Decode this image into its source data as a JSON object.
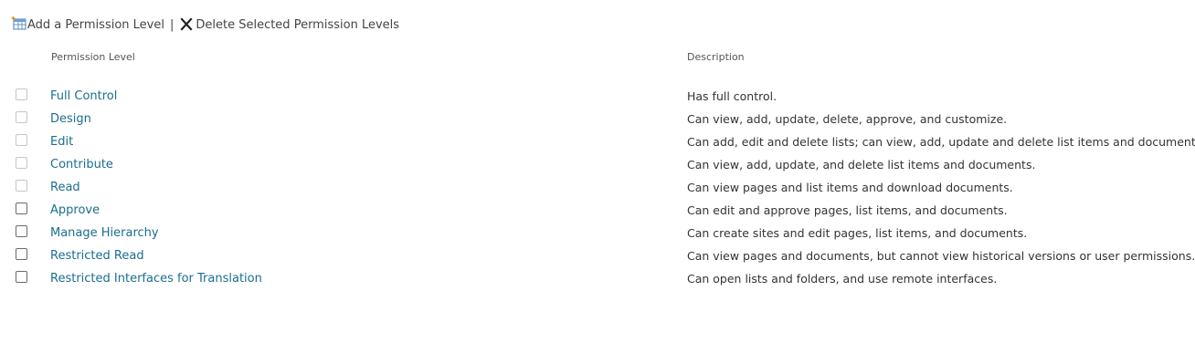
{
  "toolbar": {
    "add_label": "Add a Permission Level",
    "separator": "|",
    "delete_label": "Delete Selected Permission Levels"
  },
  "table": {
    "headers": {
      "level": "Permission Level",
      "description": "Description"
    },
    "rows": [
      {
        "name": "Full Control",
        "description": "Has full control.",
        "checkbox_enabled": false,
        "checked": false
      },
      {
        "name": "Design",
        "description": "Can view, add, update, delete, approve, and customize.",
        "checkbox_enabled": false,
        "checked": false
      },
      {
        "name": "Edit",
        "description": "Can add, edit and delete lists; can view, add, update and delete list items and documents.",
        "checkbox_enabled": false,
        "checked": false
      },
      {
        "name": "Contribute",
        "description": "Can view, add, update, and delete list items and documents.",
        "checkbox_enabled": false,
        "checked": false
      },
      {
        "name": "Read",
        "description": "Can view pages and list items and download documents.",
        "checkbox_enabled": false,
        "checked": false
      },
      {
        "name": "Approve",
        "description": "Can edit and approve pages, list items, and documents.",
        "checkbox_enabled": true,
        "checked": false
      },
      {
        "name": "Manage Hierarchy",
        "description": "Can create sites and edit pages, list items, and documents.",
        "checkbox_enabled": true,
        "checked": false
      },
      {
        "name": "Restricted Read",
        "description": "Can view pages and documents, but cannot view historical versions or user permissions.",
        "checkbox_enabled": true,
        "checked": false
      },
      {
        "name": "Restricted Interfaces for Translation",
        "description": "Can open lists and folders, and use remote interfaces.",
        "checkbox_enabled": true,
        "checked": false
      }
    ]
  },
  "icons": {
    "add": "add-permission-level-icon",
    "delete": "delete-x-icon"
  },
  "colors": {
    "link": "#1a6e8e",
    "text": "#333333",
    "header_text": "#555555",
    "checkbox_border": "#6b6b6b",
    "checkbox_disabled_border": "#c6c6c6"
  }
}
